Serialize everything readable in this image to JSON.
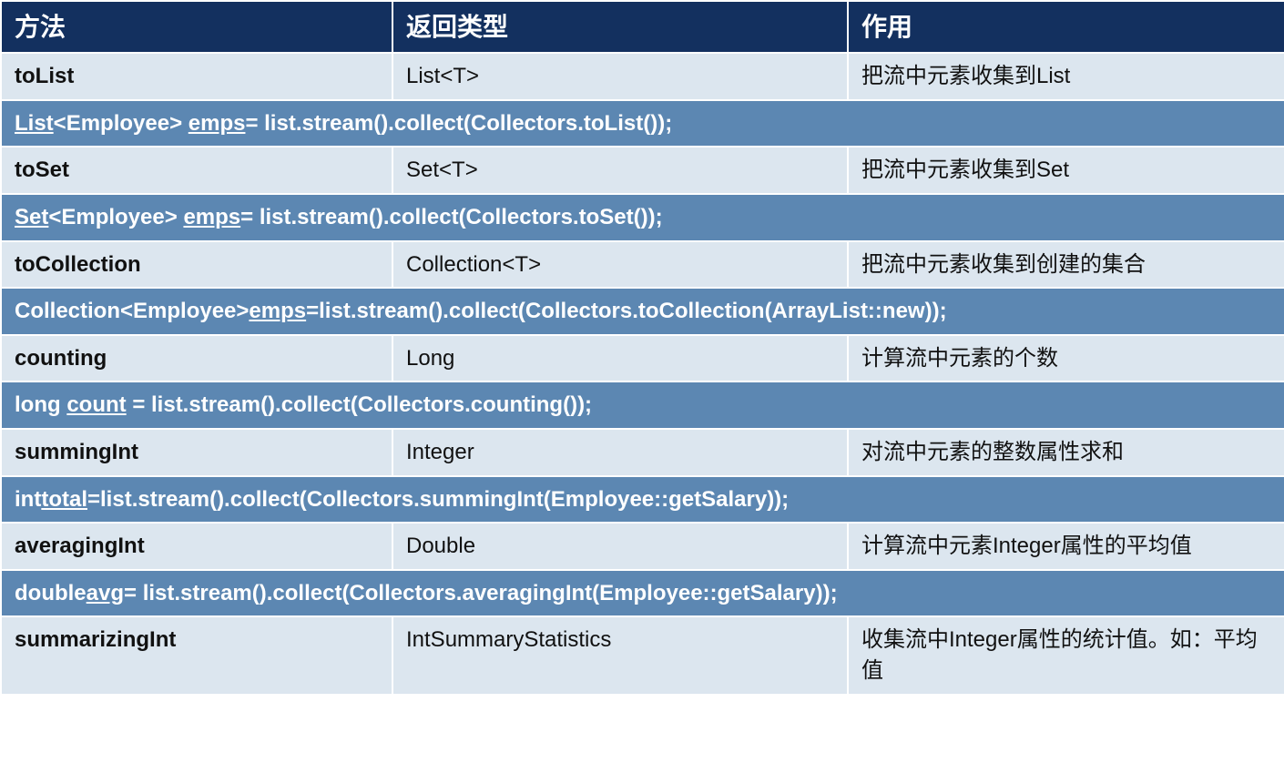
{
  "headers": {
    "method": "方法",
    "returnType": "返回类型",
    "use": "作用"
  },
  "rows": [
    {
      "method": "toList",
      "returnType": "List<T>",
      "use": "把流中元素收集到List",
      "code_pre": "List",
      "code_mid1": "<Employee> ",
      "code_ul": "emps",
      "code_post": "= list.stream().collect(Collectors.toList());"
    },
    {
      "method": "toSet",
      "returnType": "Set<T>",
      "use": "把流中元素收集到Set",
      "code_pre": "Set",
      "code_mid1": "<Employee> ",
      "code_ul": "emps",
      "code_post": "= list.stream().collect(Collectors.toSet());"
    },
    {
      "method": "toCollection",
      "returnType": "Collection<T>",
      "use": "把流中元素收集到创建的集合",
      "code_pre": "",
      "code_mid1": "Collection<Employee>",
      "code_ul": "emps",
      "code_post": "=list.stream().collect(Collectors.toCollection(ArrayList::new));"
    },
    {
      "method": "counting",
      "returnType": "Long",
      "use": "计算流中元素的个数",
      "code_pre": "",
      "code_mid1": "long ",
      "code_ul": "count",
      "code_post": " = list.stream().collect(Collectors.counting());"
    },
    {
      "method": "summingInt",
      "returnType": "Integer",
      "use": "对流中元素的整数属性求和",
      "code_pre": "",
      "code_mid1": "int",
      "code_ul": "total",
      "code_post": "=list.stream().collect(Collectors.summingInt(Employee::getSalary));"
    },
    {
      "method": "averagingInt",
      "returnType": "Double",
      "use": "计算流中元素Integer属性的平均值",
      "code_pre": "",
      "code_mid1": "double",
      "code_ul": "avg",
      "code_post": "= list.stream().collect(Collectors.averagingInt(Employee::getSalary));"
    },
    {
      "method": "summarizingInt",
      "returnType": "IntSummaryStatistics",
      "use": "收集流中Integer属性的统计值。如：平均值"
    }
  ]
}
